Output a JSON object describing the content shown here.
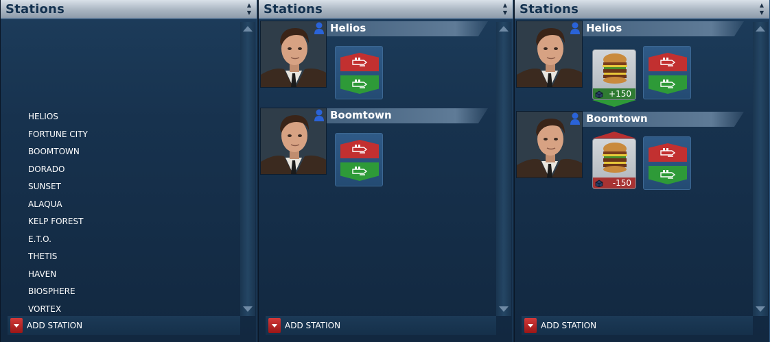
{
  "panels": [
    {
      "title": "Stations",
      "add_label": "ADD STATION"
    },
    {
      "title": "Stations",
      "add_label": "ADD STATION"
    },
    {
      "title": "Stations",
      "add_label": "ADD STATION"
    }
  ],
  "station_list": [
    "HELIOS",
    "FORTUNE CITY",
    "BOOMTOWN",
    "DORADO",
    "SUNSET",
    "ALAQUA",
    "KELP FOREST",
    "E.T.O.",
    "THETIS",
    "HAVEN",
    "BIOSPHERE",
    "VORTEX"
  ],
  "panel2_stations": [
    {
      "name": "Helios"
    },
    {
      "name": "Boomtown"
    }
  ],
  "panel3_stations": [
    {
      "name": "Helios",
      "goods_count": "+150"
    },
    {
      "name": "Boomtown",
      "goods_count": "-150"
    }
  ],
  "colors": {
    "sell": "#c23030",
    "buy": "#2e9a38",
    "header": "#aab6c2"
  },
  "icons": [
    "person-icon",
    "sell-arrow-icon",
    "buy-arrow-icon",
    "burger-icon",
    "crate-icon",
    "scroll-up-icon",
    "scroll-down-icon"
  ]
}
